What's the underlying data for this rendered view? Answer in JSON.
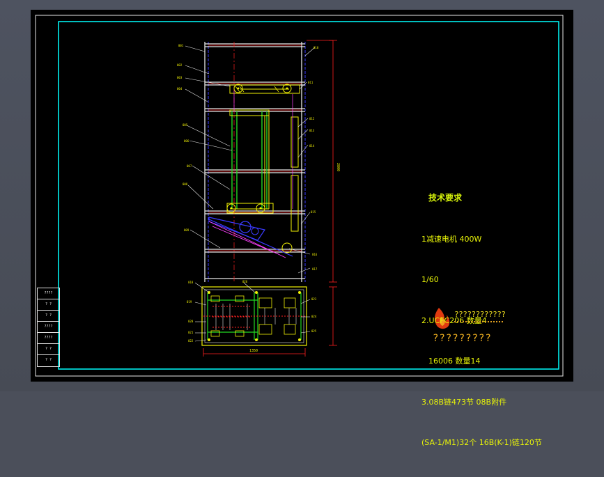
{
  "notes": {
    "title": "技术要求",
    "lines": [
      "1减速电机 400W",
      "1/60",
      "2.UCFC206 数量4",
      "16006 数量14",
      "3.08B链473节 08B附件",
      "(SA-1/M1)32个 16B(K-1)链120节"
    ]
  },
  "logo": {
    "text": "????????????",
    "brand": "?????????"
  },
  "titleblock": {
    "cells": [
      "????",
      "? ?",
      "? ?",
      "????",
      "????",
      "? ?",
      "? ?"
    ]
  },
  "dimension_labels": {
    "bottom_width": "1350",
    "right_height": "2800"
  },
  "part_labels": {
    "left": [
      "001",
      "002",
      "003",
      "004",
      "005",
      "006",
      "007",
      "008",
      "009",
      "010",
      "011",
      "012"
    ],
    "right": [
      "013",
      "014",
      "015",
      "016",
      "017",
      "018",
      "019",
      "020",
      "021",
      "022"
    ],
    "bottom_left": [
      "023",
      "024",
      "025",
      "026",
      "027"
    ],
    "bottom_right": [
      "028",
      "029",
      "030"
    ]
  },
  "colors": {
    "sheet_bg": "#000000",
    "border_white": "#ffffff",
    "border_cyan": "#00ffff",
    "frame_white": "#e8e8e8",
    "yellow": "#f2f205",
    "green": "#22d822",
    "red": "#ff2020",
    "blue": "#3a3aff",
    "magenta": "#ff40ff"
  }
}
